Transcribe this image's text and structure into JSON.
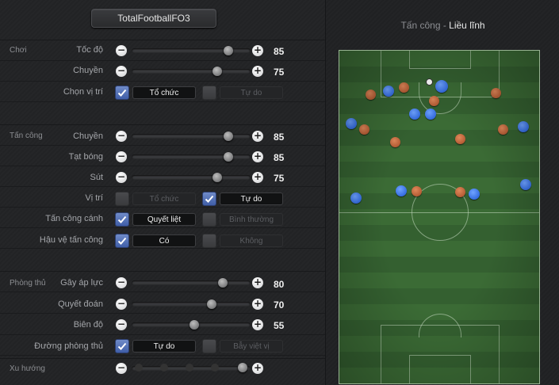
{
  "header": {
    "title": "TotalFootballFO3"
  },
  "sections": {
    "choi": "Chơi",
    "tan_cong": "Tấn công",
    "phong_thu": "Phòng thủ",
    "xu_huong": "Xu hướng"
  },
  "controls": {
    "toc_do": {
      "label": "Tốc độ",
      "value": "85",
      "level": 0.85
    },
    "chuyen1": {
      "label": "Chuyền",
      "value": "75",
      "level": 0.75
    },
    "chon_vi_tri": {
      "label": "Chọn vị trí",
      "opt_a": "Tổ chức",
      "opt_b": "Tự do",
      "selected": "opt_a"
    },
    "chuyen2": {
      "label": "Chuyền",
      "value": "85",
      "level": 0.85
    },
    "tat_bong": {
      "label": "Tạt bóng",
      "value": "85",
      "level": 0.85
    },
    "sut": {
      "label": "Sút",
      "value": "75",
      "level": 0.75
    },
    "vi_tri": {
      "label": "Vị trí",
      "opt_a": "Tổ chức",
      "opt_b": "Tự do",
      "selected": "opt_b"
    },
    "tan_cong_canh": {
      "label": "Tấn công cánh",
      "opt_a": "Quyết liệt",
      "opt_b": "Bình thường",
      "selected": "opt_a"
    },
    "hau_ve_tan_cong": {
      "label": "Hậu vệ tấn công",
      "opt_a": "Có",
      "opt_b": "Không",
      "selected": "opt_a"
    },
    "gay_ap_luc": {
      "label": "Gây áp lực",
      "value": "80",
      "level": 0.8
    },
    "quyet_doan": {
      "label": "Quyết đoán",
      "value": "70",
      "level": 0.7
    },
    "bien_do": {
      "label": "Biên độ",
      "value": "55",
      "level": 0.55
    },
    "duong_phong_thu": {
      "label": "Đường phòng thủ",
      "opt_a": "Tự do",
      "opt_b": "Bẫy việt vị",
      "selected": "opt_a"
    },
    "xu_huong": {
      "label": "",
      "steps": 5,
      "selected_step": 5
    }
  },
  "formation": {
    "title_prefix": "Tấn công",
    "separator": " - ",
    "title_mode": "Liều lĩnh"
  },
  "colors": {
    "accent_check": "#4f6fb8",
    "team_red": "#c0633a",
    "team_blue": "#2a6cf0",
    "pitch": "#3b6b35"
  },
  "icons": {
    "minus": "minus-icon",
    "plus": "plus-icon",
    "check": "check-icon",
    "ball": "ball-icon"
  }
}
